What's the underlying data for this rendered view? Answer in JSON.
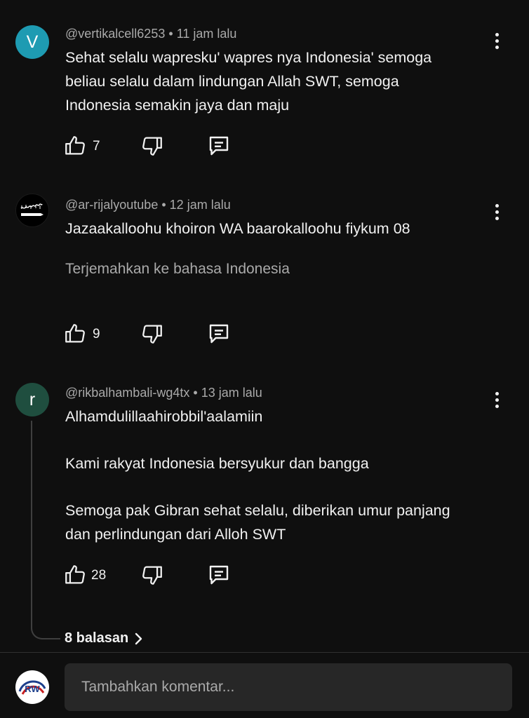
{
  "comments": [
    {
      "avatar_letter": "V",
      "avatar_color": "#1e9bb2",
      "handle": "@vertikalcell6253",
      "time": "11 jam lalu",
      "text_lines": [
        "Sehat selalu wapresku'  wapres nya Indonesia' semoga",
        "beliau selalu dalam lindungan Allah SWT, semoga",
        "Indonesia semakin jaya dan maju"
      ],
      "likes": "7"
    },
    {
      "avatar_letter": "",
      "handle": "@ar-rijalyoutube",
      "time": "12 jam lalu",
      "text": "Jazaakalloohu khoiron WA baarokalloohu fiykum 08",
      "translate": "Terjemahkan ke bahasa Indonesia",
      "likes": "9"
    },
    {
      "avatar_letter": "r",
      "avatar_color": "#1f4e3f",
      "handle": "@rikbalhambali-wg4tx",
      "time": "13 jam lalu",
      "paragraphs": [
        "Alhamdulillaahirobbil'aalamiin",
        "Kami rakyat Indonesia bersyukur dan bangga",
        "Semoga pak Gibran sehat selalu, diberikan umur panjang dan perlindungan dari Alloh SWT"
      ],
      "likes": "28",
      "replies": "8 balasan"
    }
  ],
  "meta_separator": "•",
  "input": {
    "placeholder": "Tambahkan komentar..."
  },
  "icons": {
    "more": "more-vert-icon",
    "like": "thumb-up-icon",
    "dislike": "thumb-down-icon",
    "reply": "comment-icon",
    "replies_chevron": "chevron-right-icon"
  }
}
